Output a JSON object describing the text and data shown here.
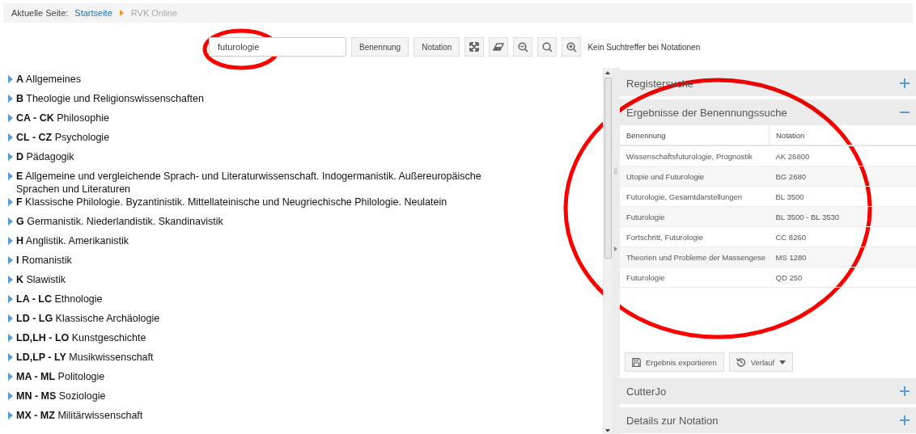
{
  "breadcrumb": {
    "label": "Aktuelle Seite:",
    "items": [
      {
        "text": "Startseite",
        "kind": "link"
      },
      {
        "text": "RVK Online",
        "kind": "current"
      }
    ]
  },
  "search": {
    "value": "futurologie",
    "buttons": [
      "Benennung",
      "Notation"
    ],
    "tools": [
      {
        "kind": "expand"
      },
      {
        "kind": "erase"
      },
      {
        "kind": "zoom-out"
      },
      {
        "kind": "search"
      },
      {
        "kind": "zoom-in"
      }
    ],
    "message": "Kein Suchtreffer bei Notationen"
  },
  "tree": [
    {
      "text": "**A** Allgemeines"
    },
    {
      "text": "**B** Theologie und Religionswissenschaften"
    },
    {
      "text": "**CA - CK** Philosophie"
    },
    {
      "text": "**CL - CZ** Psychologie"
    },
    {
      "text": "**D** Pädagogik"
    },
    {
      "text": "**E** Allgemeine und vergleichende Sprach- und Literaturwissenschaft. Indogermanistik. Außereuropäische Sprachen und Literaturen"
    },
    {
      "text": "**F** Klassische Philologie. Byzantinistik. Mittellateinische und Neugriechische Philologie. Neulatein"
    },
    {
      "text": "**G** Germanistik. Niederlandistik. Skandinavistik"
    },
    {
      "text": "**H** Anglistik. Amerikanistik"
    },
    {
      "text": "**I** Romanistik"
    },
    {
      "text": "**K** Slawistik"
    },
    {
      "text": "**LA - LC** Ethnologie"
    },
    {
      "text": "**LD - LG** Klassische Archäologie"
    },
    {
      "text": "**LD,LH - LO** Kunstgeschichte"
    },
    {
      "text": "**LD,LP - LY** Musikwissenschaft"
    },
    {
      "text": "**MA - ML** Politologie"
    },
    {
      "text": "**MN - MS** Soziologie"
    },
    {
      "text": "**MX - MZ** Militärwissenschaft"
    }
  ],
  "panels": [
    {
      "title": "Registersuche",
      "expanded": false
    },
    {
      "title": "Ergebnisse der Benennungssuche",
      "expanded": true,
      "table": {
        "columns": [
          "Benennung",
          "Notation"
        ],
        "rows": [
          [
            "Wissenschaftsfuturologie, Prognostik",
            "AK 26800"
          ],
          [
            "Utopie und Futurologie",
            "BG 2680"
          ],
          [
            "Futurologie, Gesamtdarstellungen",
            "BL 3500"
          ],
          [
            "Futurologie",
            "BL 3500 - BL 3530"
          ],
          [
            "Fortschritt, Futurologie",
            "CC 8260"
          ],
          [
            "Theorien und Probleme der Massengese",
            "MS 1280"
          ],
          [
            "Futurologie",
            "QD 250"
          ]
        ]
      },
      "actions": [
        {
          "label": "Ergebnis exportieren",
          "kind": "export"
        },
        {
          "label": "Verlauf",
          "kind": "history"
        }
      ]
    },
    {
      "title": "CutterJo",
      "expanded": false
    },
    {
      "title": "Details zur Notation",
      "expanded": false
    }
  ]
}
